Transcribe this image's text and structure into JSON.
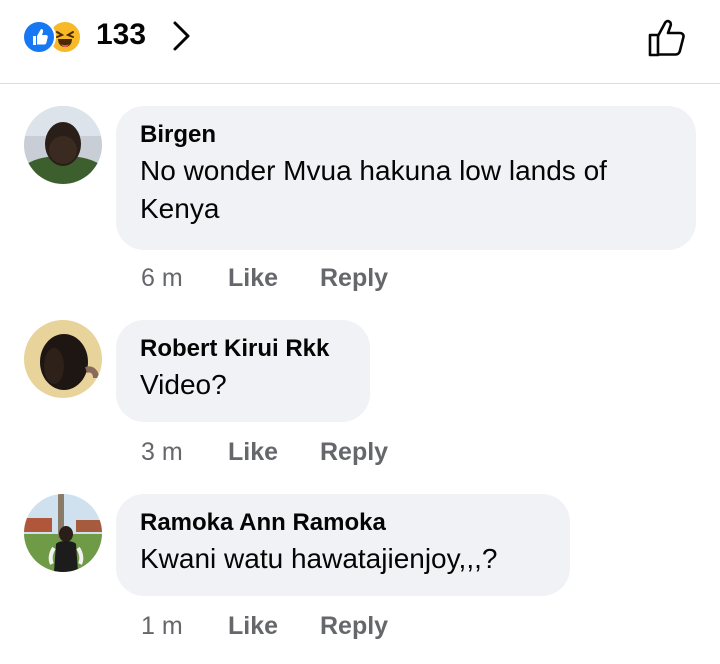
{
  "reactions": {
    "icons": [
      "like-icon",
      "haha-icon"
    ],
    "count": "133",
    "colors": {
      "like": "#1877f2",
      "haha": "#f7b928"
    }
  },
  "comments": [
    {
      "author": "Birgen",
      "text": "No wonder Mvua hakuna low lands of Kenya",
      "time": "6 m",
      "like_label": "Like",
      "reply_label": "Reply"
    },
    {
      "author": "Robert Kirui Rkk",
      "text": "Video?",
      "time": "3 m",
      "like_label": "Like",
      "reply_label": "Reply"
    },
    {
      "author": "Ramoka Ann Ramoka",
      "text": "Kwani watu hawatajienjoy,,,?",
      "time": "1 m",
      "like_label": "Like",
      "reply_label": "Reply"
    }
  ],
  "colors": {
    "bubble": "#f0f2f5",
    "meta_text": "#65676b",
    "primary_text": "#050505"
  }
}
